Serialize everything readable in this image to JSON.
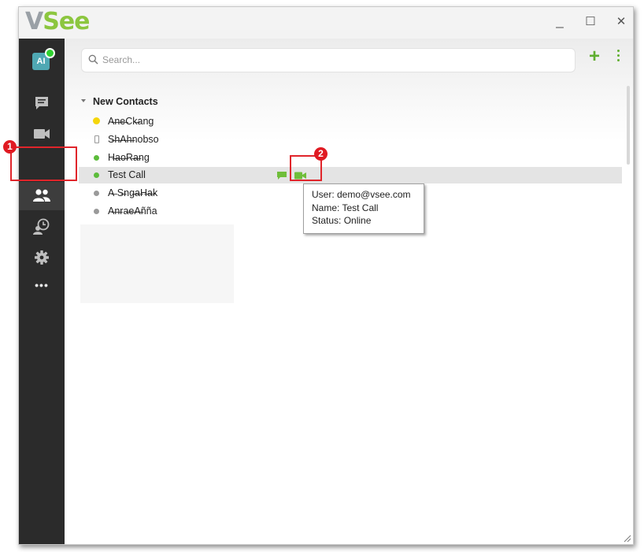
{
  "app": {
    "logo_v": "V",
    "logo_see": "See",
    "minimize": "_",
    "maximize": "☐",
    "close": "✕"
  },
  "user": {
    "initials": "AI",
    "status_color": "#2fd12f"
  },
  "sidebar": {
    "items": [
      {
        "name": "chat",
        "icon": "chat-icon"
      },
      {
        "name": "video",
        "icon": "video-icon"
      },
      {
        "name": "contacts",
        "icon": "contacts-icon",
        "active": true
      },
      {
        "name": "history",
        "icon": "history-icon"
      },
      {
        "name": "settings",
        "icon": "gear-icon"
      },
      {
        "name": "more",
        "icon": "more-icon",
        "label": "•••"
      }
    ]
  },
  "search": {
    "placeholder": "Search..."
  },
  "toolbar": {
    "add_label": "+"
  },
  "contacts": {
    "group_name": "New Contacts",
    "rows": [
      {
        "name": "A̶n̶e̶Ck̶ang",
        "status": "idle"
      },
      {
        "name": "S̶h̶A̶h̶nobso",
        "status": "phone"
      },
      {
        "name": "H̶a̶o̶R̶a̶ng",
        "status": "online"
      },
      {
        "name": "Test Call",
        "status": "online"
      },
      {
        "name": "A̶ S̶ng̶a̶H̶a̶k",
        "status": "offline"
      },
      {
        "name": "A̶n̶ra̶e̶A̶ñña",
        "status": "offline"
      }
    ]
  },
  "tooltip": {
    "user": "User: demo@vsee.com",
    "name": "Name: Test Call",
    "status": "Status: Online"
  },
  "annotations": {
    "one": "1",
    "two": "2"
  },
  "colors": {
    "accent": "#8cc63f",
    "online": "#5cbc3b",
    "offline": "#9a9a9a",
    "idle": "#f5d60a",
    "callout": "#e0252b"
  }
}
